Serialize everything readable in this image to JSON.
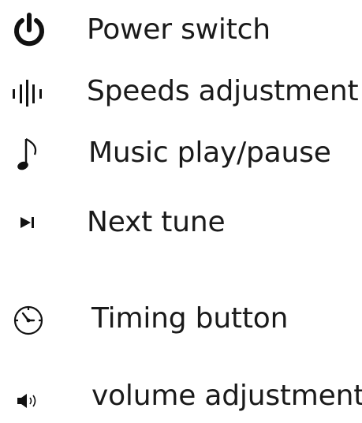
{
  "legend": {
    "items": [
      {
        "icon": "power-icon",
        "label": "Power switch"
      },
      {
        "icon": "speed-bars-icon",
        "label": "Speeds adjustment"
      },
      {
        "icon": "music-note-icon",
        "label": "Music play/pause"
      },
      {
        "icon": "next-track-icon",
        "label": "Next tune"
      },
      {
        "icon": "timer-clock-icon",
        "label": "Timing button"
      },
      {
        "icon": "speaker-volume-icon",
        "label": "volume adjustment"
      }
    ]
  },
  "colors": {
    "text": "#1a1a1a",
    "icon": "#111111",
    "background": "#ffffff"
  }
}
